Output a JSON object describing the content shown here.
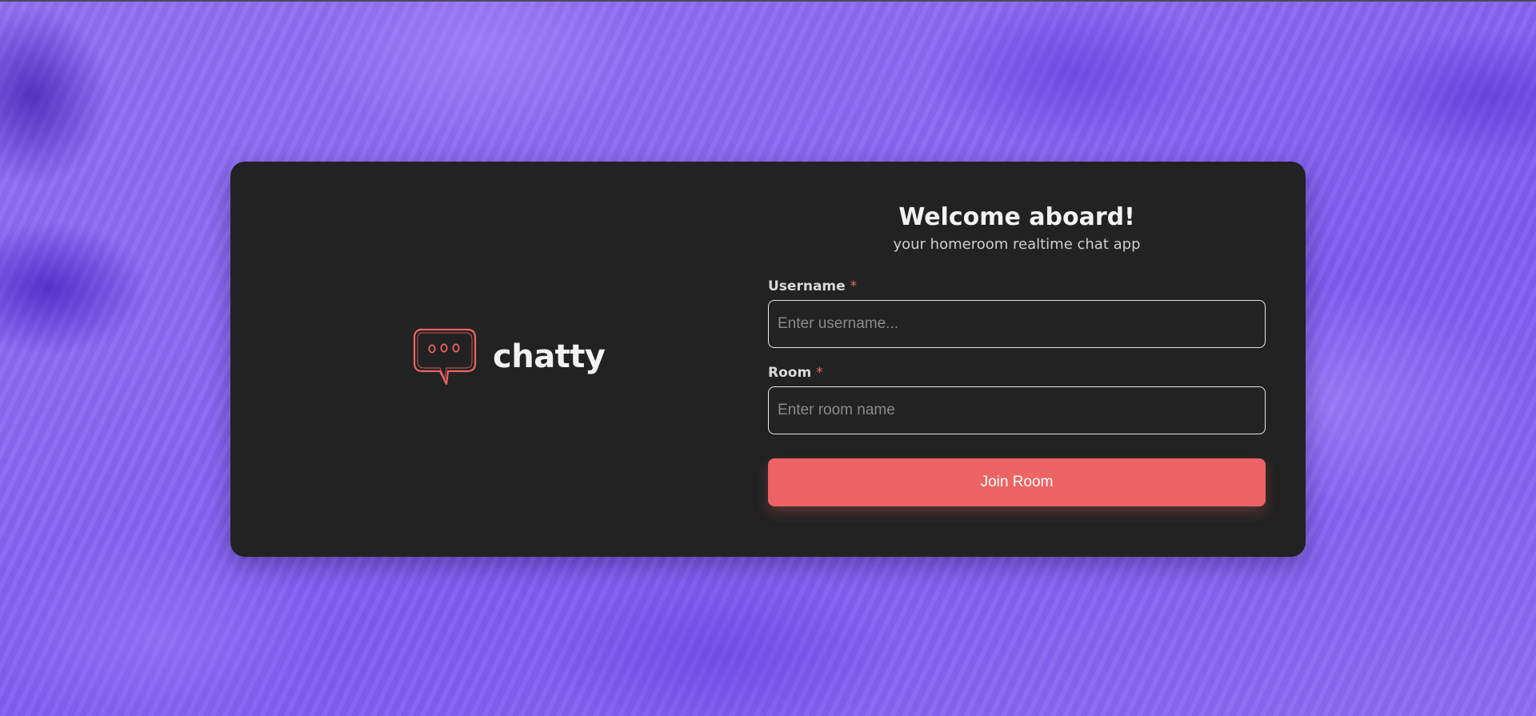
{
  "brand": {
    "name": "chatty",
    "icon": "speech-bubble-icon"
  },
  "form": {
    "title": "Welcome aboard!",
    "subtitle": "your homeroom realtime chat app",
    "username": {
      "label": "Username",
      "required_mark": "*",
      "placeholder": "Enter username...",
      "value": ""
    },
    "room": {
      "label": "Room",
      "required_mark": "*",
      "placeholder": "Enter room name",
      "value": ""
    },
    "submit_label": "Join Room"
  },
  "colors": {
    "accent": "#ee6363",
    "card_background": "#222222",
    "page_background": "#8a68f2"
  }
}
